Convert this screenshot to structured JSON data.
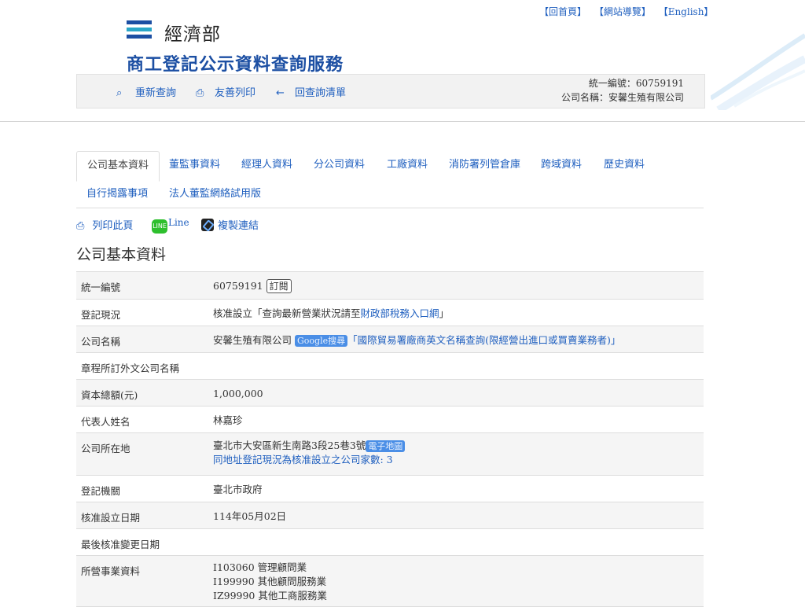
{
  "top_links": [
    "【回首頁】",
    "【網站導覽】",
    "【English】"
  ],
  "header": {
    "ministry": "經濟部",
    "service_title": "商工登記公示資料查詢服務"
  },
  "toolbar": {
    "requery": "重新查詢",
    "print_friendly": "友善列印",
    "back_list": "回查詢清單",
    "uid_line": "統一編號：60759191",
    "name_line": "公司名稱：安馨生殖有限公司"
  },
  "tabs": [
    "公司基本資料",
    "董監事資料",
    "經理人資料",
    "分公司資料",
    "工廠資料",
    "消防署列管倉庫",
    "跨域資料",
    "歷史資料"
  ],
  "tabs_row2": [
    "自行揭露事項",
    "法人董監網絡試用版"
  ],
  "actions": {
    "print_page": "列印此頁",
    "line": "Line",
    "line_icon": "LINE",
    "copy_link": "複製連結"
  },
  "section_title": "公司基本資料",
  "rows": {
    "uid": {
      "label": "統一編號",
      "value": "60759191",
      "subscribe": "訂閱"
    },
    "status": {
      "label": "登記現況",
      "value_prefix": "核准設立",
      "quote_open": "「查詢最新營業狀況請至",
      "link": "財政部稅務入口網",
      "quote_close": "」"
    },
    "company_name": {
      "label": "公司名稱",
      "value": "安馨生殖有限公司",
      "google": "Google搜尋",
      "link": "「國際貿易署廠商英文名稱查詢(限經營出進口或買賣業務者)」"
    },
    "foreign_name": {
      "label": "章程所訂外文公司名稱",
      "value": ""
    },
    "capital": {
      "label": "資本總額(元)",
      "value": "1,000,000"
    },
    "representative": {
      "label": "代表人姓名",
      "value": "林嘉珍"
    },
    "address": {
      "label": "公司所在地",
      "value": "臺北市大安區新生南路3段25巷3號",
      "emap": "電子地圖",
      "same_addr": "同地址登記現況為核准設立之公司家數: 3"
    },
    "authority": {
      "label": "登記機關",
      "value": "臺北市政府"
    },
    "approved_date": {
      "label": "核准設立日期",
      "value": "114年05月02日"
    },
    "last_change": {
      "label": "最後核准變更日期",
      "value": ""
    },
    "business": {
      "label": "所營事業資料",
      "items": [
        "I103060 管理顧問業",
        "I199990 其他顧問服務業",
        "IZ99990 其他工商服務業"
      ]
    }
  }
}
